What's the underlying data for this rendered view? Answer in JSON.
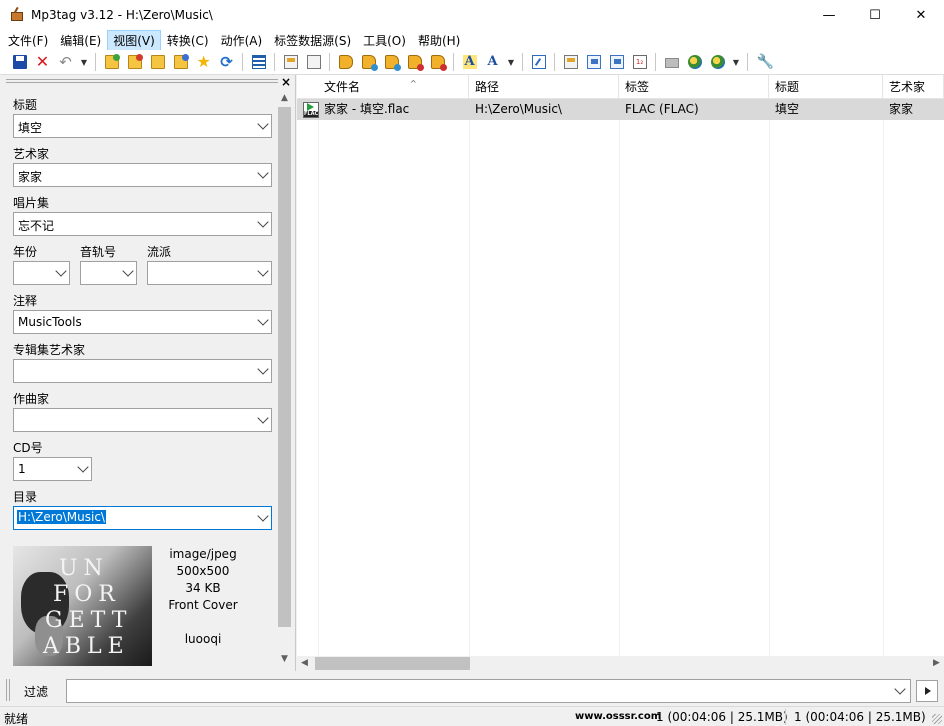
{
  "window": {
    "title": "Mp3tag v3.12  -  H:\\Zero\\Music\\",
    "minimize": "—",
    "maximize": "☐",
    "close": "✕"
  },
  "menu": [
    {
      "label": "文件(F)"
    },
    {
      "label": "编辑(E)"
    },
    {
      "label": "视图(V)"
    },
    {
      "label": "转换(C)"
    },
    {
      "label": "动作(A)"
    },
    {
      "label": "标签数据源(S)"
    },
    {
      "label": "工具(O)"
    },
    {
      "label": "帮助(H)"
    }
  ],
  "toolbar": {
    "icons": [
      "save-icon",
      "delete-icon",
      "undo-icon",
      "change-directory-icon",
      "add-directory-icon",
      "favorite-directory-icon",
      "playlist-icon",
      "star-icon",
      "refresh-icon",
      "tag-panel-icon",
      "copy-tag-icon",
      "paste-tag-icon",
      "tag-filename-icon",
      "filename-tag-icon",
      "text-file-tag-icon",
      "tag-tag-icon",
      "filename-filename-icon",
      "actions-icon",
      "quick-actions-icon",
      "edit-tag-icon",
      "export-icon",
      "playlist-export-icon",
      "auto-number-icon",
      "freedb-icon",
      "web-sources-icon",
      "discogs-icon",
      "options-icon"
    ]
  },
  "tag_panel": {
    "fields": [
      {
        "label": "标题",
        "value": "填空"
      },
      {
        "label": "艺术家",
        "value": "家家"
      },
      {
        "label": "唱片集",
        "value": "忘不记"
      }
    ],
    "year": {
      "label": "年份",
      "value": ""
    },
    "track": {
      "label": "音轨号",
      "value": ""
    },
    "genre": {
      "label": "流派",
      "value": ""
    },
    "comment": {
      "label": "注释",
      "value": "MusicTools"
    },
    "album_artist": {
      "label": "专辑集艺术家",
      "value": ""
    },
    "composer": {
      "label": "作曲家",
      "value": ""
    },
    "disc": {
      "label": "CD号",
      "value": "1"
    },
    "directory": {
      "label": "目录",
      "value": "H:\\Zero\\Music\\"
    },
    "cover": {
      "mime": "image/jpeg",
      "dimensions": "500x500",
      "size": "34 KB",
      "type": "Front Cover",
      "description": "luooqi",
      "art_text": [
        "UN",
        "FOR",
        "GETT",
        "ABLE"
      ]
    }
  },
  "file_list": {
    "columns": [
      "文件名",
      "路径",
      "标签",
      "标题",
      "艺术家"
    ],
    "rows": [
      {
        "filename": "家家 - 填空.flac",
        "path": "H:\\Zero\\Music\\",
        "tag": "FLAC (FLAC)",
        "title": "填空",
        "artist": "家家",
        "icon_label": "FLAC"
      }
    ]
  },
  "filter": {
    "label": "过滤",
    "value": ""
  },
  "status": {
    "left": "就绪",
    "brand": "www.osssr.com",
    "selected": "1 (00:04:06 | 25.1MB)",
    "total": "1 (00:04:06 | 25.1MB)"
  }
}
